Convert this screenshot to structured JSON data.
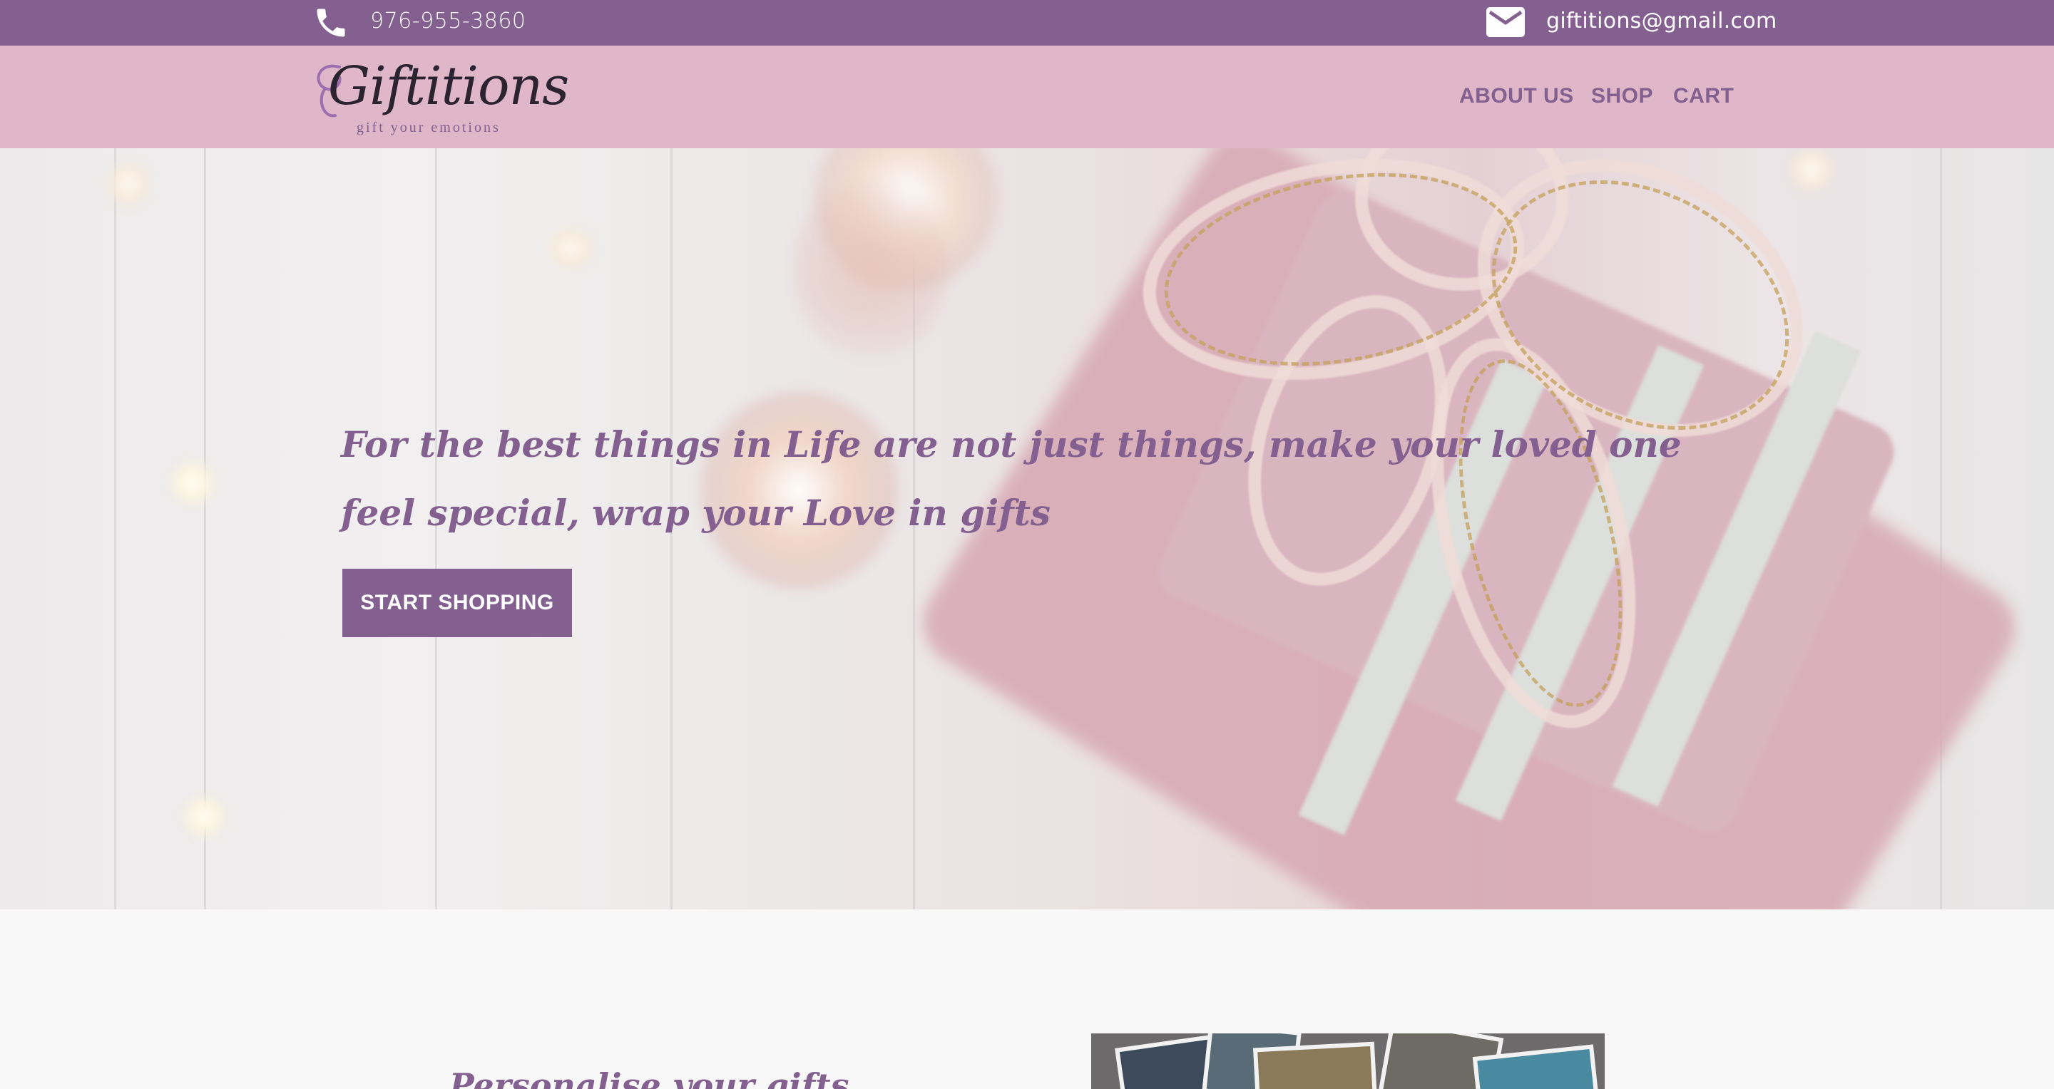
{
  "topbar": {
    "phone": "976-955-3860",
    "email": "giftitions@gmail.com",
    "phone_icon": "phone-icon",
    "email_icon": "mail-icon"
  },
  "header": {
    "logo_text": "Giftitions",
    "logo_tagline": "gift your emotions",
    "nav": {
      "about": "ABOUT US",
      "shop": "SHOP",
      "cart": "CART"
    }
  },
  "hero": {
    "tagline": "For the best things in Life are not just things, make your loved one feel special, wrap your Love in gifts",
    "cta_label": "START SHOPPING"
  },
  "section": {
    "title": "Personalise your gifts"
  },
  "colors": {
    "brand_purple": "#83608f",
    "header_pink": "#dfb7c8",
    "page_bg": "#f8f8f8"
  }
}
